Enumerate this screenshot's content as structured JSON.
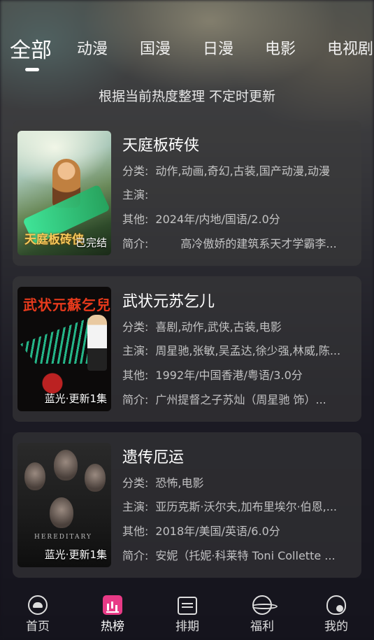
{
  "tabs": [
    "全部",
    "动漫",
    "国漫",
    "日漫",
    "电影",
    "电视剧"
  ],
  "active_tab": "全部",
  "subtitle": "根据当前热度整理 不定时更新",
  "labels": {
    "category": "分类:",
    "cast": "主演:",
    "other": "其他:",
    "intro": "简介:"
  },
  "items": [
    {
      "title": "天庭板砖侠",
      "badge": "已完结",
      "poster_logo": "天庭板砖侠",
      "category": "动作,动画,奇幻,古装,国产动漫,动漫",
      "cast": "",
      "other": "2024年/内地/国语/2.0分",
      "intro": "高冷傲娇的建筑系天才学霸李..."
    },
    {
      "title": "武状元苏乞儿",
      "badge": "蓝光·更新1集",
      "poster_logo": "武状元蘇乞兒",
      "category": "喜剧,动作,武侠,古装,电影",
      "cast": "周星驰,张敏,吴孟达,徐少强,林威,陈...",
      "other": "1992年/中国香港/粤语/3.0分",
      "intro": "广州提督之子苏灿（周星驰 饰）..."
    },
    {
      "title": "遗传厄运",
      "badge": "蓝光·更新1集",
      "poster_logo": "HEREDITARY",
      "category": "恐怖,电影",
      "cast": "亚历克斯·沃尔夫,加布里埃尔·伯恩,...",
      "other": "2018年/美国/英语/6.0分",
      "intro": "安妮（托妮·科莱特 Toni Collette ..."
    }
  ],
  "nav": [
    {
      "label": "首页",
      "icon": "home-icon"
    },
    {
      "label": "热榜",
      "icon": "hot-chart-icon"
    },
    {
      "label": "排期",
      "icon": "calendar-icon"
    },
    {
      "label": "福利",
      "icon": "planet-gift-icon"
    },
    {
      "label": "我的",
      "icon": "profile-icon"
    }
  ],
  "colors": {
    "accent": "#e83a86"
  }
}
